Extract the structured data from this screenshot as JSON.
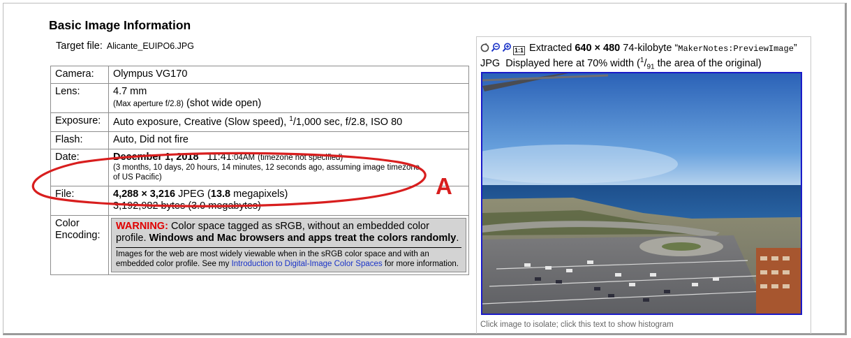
{
  "section_title": "Basic Image Information",
  "target": {
    "label": "Target file:",
    "filename": "Alicante_EUIPO6.JPG"
  },
  "rows": {
    "camera": {
      "label": "Camera:",
      "value": "Olympus VG170"
    },
    "lens": {
      "label": "Lens:",
      "focal": "4.7 mm",
      "aperture": "(Max aperture f/2.8)",
      "note": "(shot wide open)"
    },
    "exposure": {
      "label": "Exposure:",
      "mode": "Auto exposure, Creative (Slow speed),",
      "shutter_num": "1",
      "shutter_rest": "/1,000 sec, f/2.8, ISO 80"
    },
    "flash": {
      "label": "Flash:",
      "value": "Auto, Did not fire"
    },
    "date": {
      "label": "Date:",
      "date": "December 1, 2018",
      "time_hm": "11:41",
      "time_s": ":04AM",
      "tz_note": "(timezone not specified)",
      "ago": "(3 months, 10 days, 20 hours, 14 minutes, 12 seconds ago, assuming image timezone of US Pacific)"
    },
    "file": {
      "label": "File:",
      "dims": "4,288 × 3,216",
      "fmt": "JPEG (",
      "mp": "13.8",
      "mp_unit": "megapixels)",
      "bytes": "3,192,982 bytes (3.0 megabytes)"
    },
    "color": {
      "label": "Color Encoding:",
      "warning_label": "WARNING:",
      "warning_text": "Color space tagged as sRGB, without an embedded color profile.",
      "warning_bold": "Windows and Mac browsers and apps treat the colors randomly",
      "warning_end": ".",
      "info_text": "Images for the web are most widely viewable when in the sRGB color space and with an embedded color profile. See my",
      "link_text": "Introduction to Digital-Image Color Spaces",
      "info_end": "for more information."
    }
  },
  "annotation": {
    "letter": "A",
    "color": "#d81e1e"
  },
  "preview": {
    "extracted_label": "Extracted",
    "size": "640 × 480",
    "kb": "74-kilobyte",
    "tag_open": "“",
    "tag": "MakerNotes:PreviewImage",
    "tag_close": "”",
    "jpg_line": "JPG  Displayed here at 70% width (",
    "frac_num": "1",
    "frac_den": "91",
    "frac_rest": " the area of the original)",
    "caption": "Click image to isolate; click this text to show histogram",
    "icons": [
      "reset-icon",
      "zoom-out-icon",
      "zoom-in-icon",
      "actual-size-icon"
    ],
    "actual_size_label": "1:1"
  },
  "colors": {
    "warning": "#e00000",
    "link": "#1a33c7",
    "photo_border": "#1a1ac8",
    "warn_bg": "#d3d3d3"
  }
}
